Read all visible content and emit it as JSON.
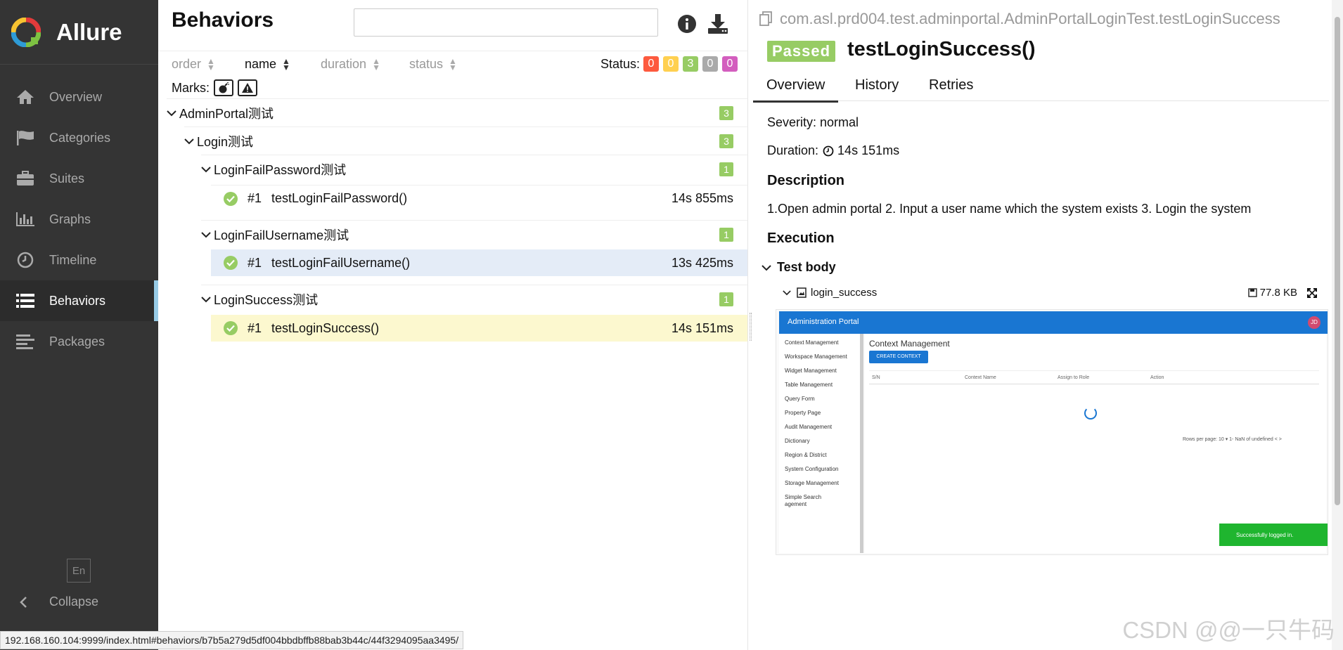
{
  "sidebar": {
    "brand": "Allure",
    "items": [
      {
        "label": "Overview",
        "icon": "home-icon"
      },
      {
        "label": "Categories",
        "icon": "flag-icon"
      },
      {
        "label": "Suites",
        "icon": "briefcase-icon"
      },
      {
        "label": "Graphs",
        "icon": "bar-chart-icon"
      },
      {
        "label": "Timeline",
        "icon": "clock-icon"
      },
      {
        "label": "Behaviors",
        "icon": "list-icon"
      },
      {
        "label": "Packages",
        "icon": "align-left-icon"
      }
    ],
    "lang": "En",
    "collapse": "Collapse"
  },
  "middle": {
    "title": "Behaviors",
    "search_value": "",
    "sort": {
      "order": "order",
      "name": "name",
      "duration": "duration",
      "status": "status"
    },
    "status_label": "Status:",
    "status_counts": {
      "failed": "0",
      "broken": "0",
      "passed": "3",
      "skipped": "0",
      "unknown": "0"
    },
    "marks_label": "Marks:",
    "tree": {
      "root": {
        "label": "AdminPortal测试",
        "count": "3"
      },
      "feature": {
        "label": "Login测试",
        "count": "3"
      },
      "stories": [
        {
          "label": "LoginFailPassword测试",
          "count": "1",
          "test": {
            "num": "#1",
            "name": "testLoginFailPassword()",
            "duration": "14s 855ms"
          }
        },
        {
          "label": "LoginFailUsername测试",
          "count": "1",
          "test": {
            "num": "#1",
            "name": "testLoginFailUsername()",
            "duration": "13s 425ms"
          }
        },
        {
          "label": "LoginSuccess测试",
          "count": "1",
          "test": {
            "num": "#1",
            "name": "testLoginSuccess()",
            "duration": "14s 151ms"
          }
        }
      ]
    }
  },
  "detail": {
    "full_name": "com.asl.prd004.test.adminportal.AdminPortalLoginTest.testLoginSuccess",
    "status": "Passed",
    "title": "testLoginSuccess()",
    "tabs": [
      "Overview",
      "History",
      "Retries"
    ],
    "severity": "Severity: normal",
    "duration_label": "Duration:",
    "duration_value": "14s 151ms",
    "description_heading": "Description",
    "description": "1.Open admin portal 2. Input a user name which the system exists 3. Login the system",
    "execution_heading": "Execution",
    "test_body": "Test body",
    "attachment": {
      "name": "login_success",
      "size": "77.8 KB"
    },
    "screenshot": {
      "app_title": "Administration Portal",
      "avatar": "JD",
      "menu": [
        "Context Management",
        "Workspace Management",
        "Widget Management",
        "Table Management",
        "Query Form",
        "Property Page",
        "Audit Management",
        "Dictionary",
        "Region & District",
        "System Configuration",
        "Storage Management",
        "Simple Search",
        "agement"
      ],
      "heading": "Context Management",
      "button": "CREATE CONTEXT",
      "columns": [
        "S/N",
        "Context Name",
        "Assign to Role",
        "Action"
      ],
      "pager": "Rows per page:  10 ▾      1- NaN of undefined     <    >",
      "toast": "Successfully logged in."
    }
  },
  "status_bar": "192.168.160.104:9999/index.html#behaviors/b7b5a279d5df004bbdbffb88bab3b44c/44f3294095aa3495/",
  "watermark": "CSDN @@一只牛码",
  "colors": {
    "passed": "#97cc64",
    "failed": "#fd5a3e",
    "broken": "#ffd050",
    "skipped": "#aaaaaa",
    "unknown": "#d35ebe",
    "sidebar": "#343434",
    "accent": "#97cbe6"
  }
}
